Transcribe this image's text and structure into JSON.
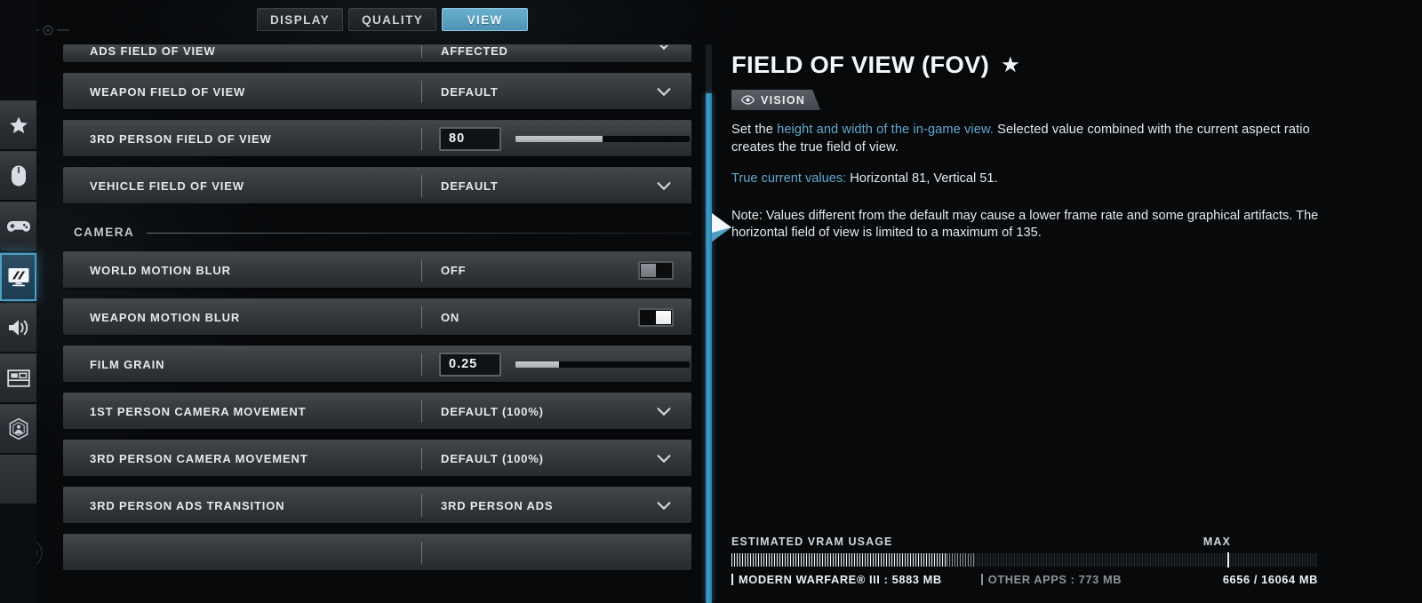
{
  "colors": {
    "accent_blue": "#63a8cd",
    "tab_active_bg": "#5aa0c0",
    "divider_blue": "#3f9cc9",
    "row_bg": "#383c41",
    "panel_bg": "#07090b"
  },
  "sidebar": {
    "items": [
      {
        "icon": "star-icon",
        "name": "favorites",
        "selected": false
      },
      {
        "icon": "mouse-icon",
        "name": "mouse-keyboard",
        "selected": false
      },
      {
        "icon": "gamepad-icon",
        "name": "controller",
        "selected": false
      },
      {
        "icon": "monitor-icon",
        "name": "graphics",
        "selected": true
      },
      {
        "icon": "speaker-icon",
        "name": "audio",
        "selected": false
      },
      {
        "icon": "interface-icon",
        "name": "interface",
        "selected": false
      },
      {
        "icon": "account-icon",
        "name": "account",
        "selected": false
      },
      {
        "icon": "blank-icon",
        "name": "blank",
        "selected": false
      }
    ]
  },
  "tabs": [
    {
      "label": "DISPLAY",
      "active": false
    },
    {
      "label": "QUALITY",
      "active": false
    },
    {
      "label": "VIEW",
      "active": true
    }
  ],
  "settings": [
    {
      "kind": "dropdown",
      "clipped": true,
      "label": "ADS FIELD OF VIEW",
      "value": "AFFECTED"
    },
    {
      "kind": "dropdown",
      "label": "WEAPON FIELD OF VIEW",
      "value": "DEFAULT"
    },
    {
      "kind": "slider",
      "label": "3RD PERSON FIELD OF VIEW",
      "value": "80",
      "fill_percent": 50
    },
    {
      "kind": "dropdown",
      "label": "VEHICLE FIELD OF VIEW",
      "value": "DEFAULT"
    },
    {
      "kind": "section",
      "label": "CAMERA"
    },
    {
      "kind": "toggle",
      "label": "WORLD MOTION BLUR",
      "value": "OFF",
      "on": false
    },
    {
      "kind": "toggle",
      "label": "WEAPON MOTION BLUR",
      "value": "ON",
      "on": true
    },
    {
      "kind": "slider",
      "label": "FILM GRAIN",
      "value": "0.25",
      "fill_percent": 25
    },
    {
      "kind": "dropdown",
      "label": "1ST PERSON CAMERA MOVEMENT",
      "value": "DEFAULT (100%)"
    },
    {
      "kind": "dropdown",
      "label": "3RD PERSON CAMERA MOVEMENT",
      "value": "DEFAULT (100%)"
    },
    {
      "kind": "dropdown",
      "label": "3RD PERSON ADS TRANSITION",
      "value": "3RD PERSON ADS"
    },
    {
      "kind": "dropdown",
      "clipped_bottom": true,
      "label": "",
      "value": ""
    }
  ],
  "info": {
    "title": "FIELD OF VIEW (FOV)",
    "favorite_star": "★",
    "badge": {
      "icon": "eye-icon",
      "label": "VISION"
    },
    "desc_pre": "Set the ",
    "desc_accent": "height and width of the in-game view.",
    "desc_post": " Selected value combined with the current aspect ratio creates the true field of view.",
    "true_values_label": "True current values:",
    "true_values": " Horizontal 81, Vertical 51.",
    "note": "Note: Values different from the default may cause a lower frame rate and some graphical artifacts. The horizontal field of view is limited to a maximum of 135."
  },
  "vram": {
    "title": "ESTIMATED VRAM USAGE",
    "max_label": "MAX",
    "game_label": "MODERN WARFARE® III : 5883 MB",
    "other_label": "OTHER APPS : 773 MB",
    "total_label": "6656 / 16064 MB",
    "game_percent": 36.6,
    "other_percent": 4.8,
    "max_percent": 84.5
  }
}
